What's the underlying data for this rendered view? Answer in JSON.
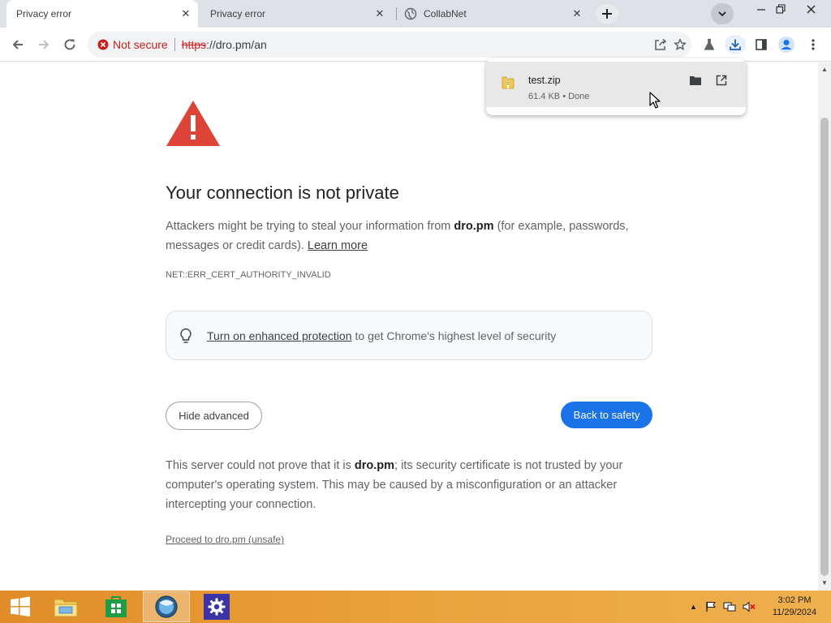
{
  "tabs": [
    {
      "title": "Privacy error",
      "active": true
    },
    {
      "title": "Privacy error",
      "active": false
    },
    {
      "title": "CollabNet",
      "active": false
    }
  ],
  "toolbar": {
    "security_label": "Not secure",
    "url_scheme": "https",
    "url_rest": "://dro.pm/an"
  },
  "download": {
    "filename": "test.zip",
    "status": "61.4 KB • Done"
  },
  "page": {
    "heading": "Your connection is not private",
    "intro_before": "Attackers might be trying to steal your information from ",
    "intro_domain": "dro.pm",
    "intro_after": " (for example, passwords, messages or credit cards). ",
    "learn_more": "Learn more",
    "error_code": "NET::ERR_CERT_AUTHORITY_INVALID",
    "enhanced_link": "Turn on enhanced protection",
    "enhanced_rest": "to get Chrome's highest level of security",
    "hide_advanced": "Hide advanced",
    "back_to_safety": "Back to safety",
    "details_before": "This server could not prove that it is ",
    "details_domain": "dro.pm",
    "details_after": "; its security certificate is not trusted by your computer's operating system. This may be caused by a misconfiguration or an attacker intercepting your connection.",
    "proceed": "Proceed to dro.pm (unsafe)"
  },
  "taskbar": {
    "time": "3:02 PM",
    "date": "11/29/2024"
  },
  "colors": {
    "accent_blue": "#1a73e8",
    "warning_red": "#db4437",
    "not_secure_red": "#c5221f"
  }
}
